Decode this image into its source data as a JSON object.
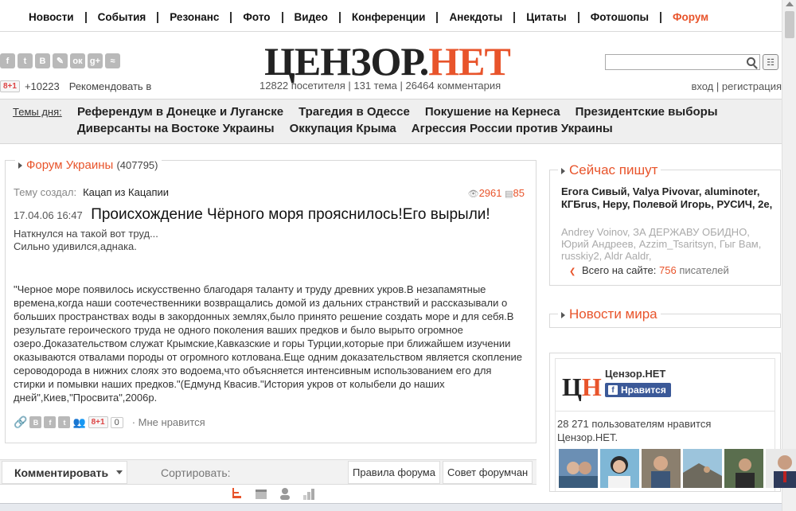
{
  "nav": {
    "items": [
      "Новости",
      "События",
      "Резонанс",
      "Фото",
      "Видео",
      "Конференции",
      "Анекдоты",
      "Цитаты",
      "Фотошопы",
      "Форум"
    ]
  },
  "social": {
    "icons": [
      {
        "name": "facebook-icon",
        "glyph": "f"
      },
      {
        "name": "twitter-icon",
        "glyph": "t"
      },
      {
        "name": "vkontakte-icon",
        "glyph": "B"
      },
      {
        "name": "livejournal-icon",
        "glyph": "✎"
      },
      {
        "name": "odnoklassniki-icon",
        "glyph": "ок"
      },
      {
        "name": "google-plus-icon",
        "glyph": "g+"
      },
      {
        "name": "rss-icon",
        "glyph": "≈"
      }
    ],
    "gplus_badge": "8+1",
    "gplus_count": "+10223",
    "recommend": "Рекомендовать в"
  },
  "logo": {
    "part1": "ЦЕНЗОР.",
    "part2": "НЕТ"
  },
  "stats": "12822 посетителя | 131 тема | 26464 комментария",
  "auth": {
    "login": "вход",
    "sep": " | ",
    "register": "регистрация"
  },
  "topics": {
    "label": "Темы дня:",
    "row1": [
      "Референдум в Донецке и Луганске",
      "Трагедия в Одессе",
      "Покушение на Кернеса",
      "Президентские выборы"
    ],
    "row2": [
      "Диверсанты на Востоке Украины",
      "Оккупация Крыма",
      "Агрессия России против Украины"
    ]
  },
  "forum": {
    "title": "Форум Украины",
    "count": "(407795)",
    "creator_label": "Тему создал:",
    "creator": "Кацап из Кацапии",
    "views": "2961",
    "comments": "85",
    "date": "17.04.06 16:47",
    "post_title": "Происхождение Чёрного моря прояснилось!Его вырыли!",
    "intro": [
      "Наткнулся на такой вот труд...",
      "Сильно удивился,аднака."
    ],
    "quote": "\"Черное море появилось искусственно благодаря таланту и труду древних укров.В незапамятные времена,когда наши соотечественники возвращались домой из дальних странствий и рассказывали о больших пространствах воды в закордонных землях,было принято решение создать море и для себя.В результате героического труда не одного поколения ваших предков и было вырыто огромное озеро.Доказательством служат Крымские,Кавказские и горы Турции,которые при ближайшем изучении оказываются отвалами породы от огромного котлована.Еще одним доказательством является скопление сероводорода в нижних слоях это водоема,что объясняется интенсивным использованием его для стирки и помывки наших предков.\"(Едмунд Квасив.\"История укров от колыбели до наших дней\",Киев,\"Просвита\",2006р.",
    "gplus": "8+1",
    "zero": "0",
    "dislike": "Мне нравится"
  },
  "commentbar": {
    "comment": "Комментировать",
    "sort": "Сортировать:",
    "rules": "Правила форума",
    "advice": "Совет форумчан"
  },
  "now_writing": {
    "title": "Сейчас пишут",
    "names": "Егога Сивый, Valya Pivovar, aluminoter, КГБrus, Нерy, Полевой Игорь, РУСИЧ, 2е,",
    "guests": "Andrey Voinov, ЗА ДЕРЖАВУ ОБИДНО, Юрий Андреев, Azzim_Tsaritsyn, Гыг Вам, russkiy2, Aldr Aaldr,",
    "online_label": "Всего на сайте:",
    "online_count": "756",
    "online_unit": "писателей"
  },
  "world_news": {
    "title": "Новости мира"
  },
  "facebook": {
    "page_name": "Цензор.НЕТ",
    "like_button": "Нравится",
    "fans_text": "28 271 пользователям нравится Цензор.НЕТ.",
    "logo_c": "Ц",
    "logo_n": "Н"
  },
  "colors": {
    "accent": "#e8542b",
    "facebook": "#3b5998"
  }
}
